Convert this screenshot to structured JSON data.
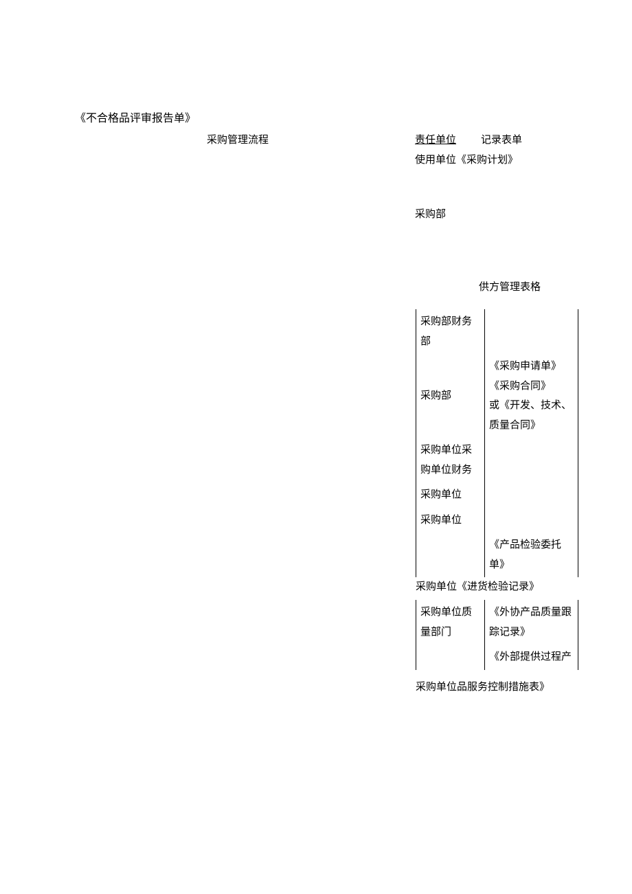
{
  "title": "《不合格品评审报告单》",
  "flow_title": "采购管理流程",
  "header": {
    "responsibility": "责任单位",
    "record_form": "记录表单"
  },
  "usage_unit": "使用单位《采购计划》",
  "purch_dept": "采购部",
  "supplier_table_title": "供方管理表格",
  "table1": {
    "rows": [
      {
        "left": "采购部财务部",
        "right": ""
      },
      {
        "left": "采购部",
        "right": "《采购申请单》\n《采购合同》\n或《开发、技术、质量合同》"
      },
      {
        "left": "采购单位采购单位财务",
        "right": ""
      },
      {
        "left": "采购单位",
        "right": ""
      },
      {
        "left": "采购单位",
        "right": ""
      },
      {
        "left": "",
        "right": "《产品检验委托单》"
      }
    ]
  },
  "purch_unit_record": "采购单位《进货检验记录》",
  "table2": {
    "rows": [
      {
        "left": "采购单位质量部门",
        "right": "《外协产品质量跟踪记录》"
      },
      {
        "left": "",
        "right": "《外部提供过程产"
      }
    ]
  },
  "footer_text": "采购单位品服务控制措施表》"
}
